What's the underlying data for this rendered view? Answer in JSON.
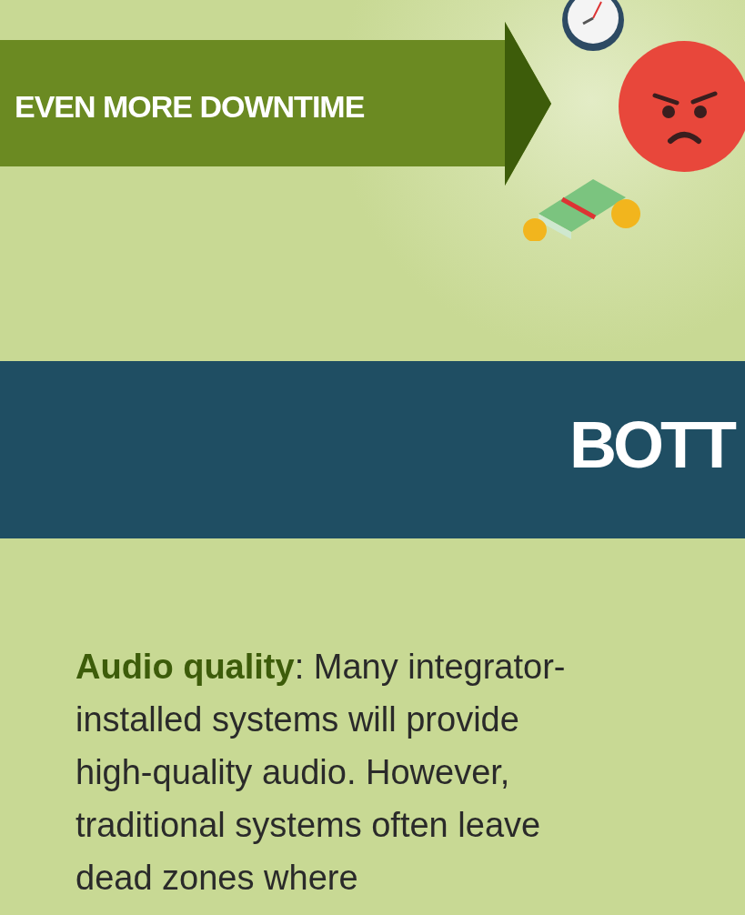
{
  "banner": {
    "label": "EVEN MORE DOWNTIME"
  },
  "section_heading": {
    "text": "BOTT"
  },
  "paragraph": {
    "text": "**Audio quality**: Many integrator-installed systems will provide high-quality audio. However, traditional systems often leave dead zones where"
  }
}
